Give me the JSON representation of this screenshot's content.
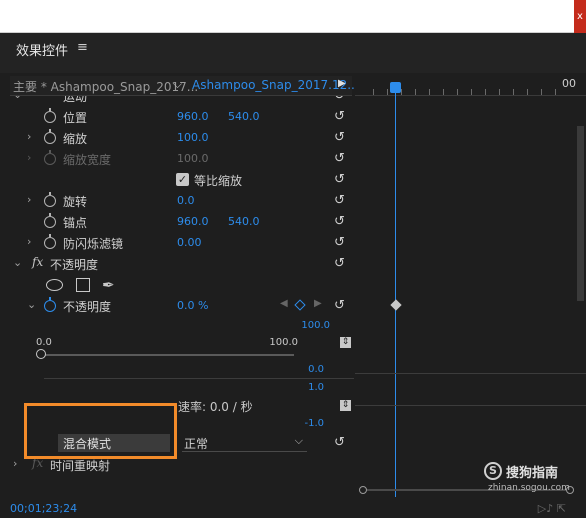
{
  "panel": {
    "title": "效果控件",
    "menu_icon": "≡"
  },
  "tabs": {
    "master": "主要 * Ashampoo_Snap_2017...",
    "chevron": "⌵",
    "clip": "Ashampoo_Snap_2017.12...",
    "arrow": "▶"
  },
  "timeline": {
    "ruler_label": "00"
  },
  "motion": {
    "cut_label": "运动",
    "rows": [
      {
        "label": "位置",
        "v1": "960.0",
        "v2": "540.0"
      },
      {
        "label": "缩放",
        "v1": "100.0"
      },
      {
        "label": "缩放宽度",
        "v1": "100.0",
        "disabled": true
      },
      {
        "label": "等比缩放",
        "checked": true
      },
      {
        "label": "旋转",
        "v1": "0.0"
      },
      {
        "label": "锚点",
        "v1": "960.0",
        "v2": "540.0"
      },
      {
        "label": "防闪烁滤镜",
        "v1": "0.00"
      }
    ]
  },
  "opacity": {
    "header": "不透明度",
    "fx": "fx",
    "row_label": "不透明度",
    "value": "0.0 %",
    "graph": {
      "max": "100.0",
      "min_left": "0.0",
      "max_mid": "100.0",
      "zero": "0.0",
      "one": "1.0",
      "minus_one": "-1.0",
      "speed": "速率: 0.0 / 秒"
    },
    "blend_label": "混合模式",
    "blend_value": "正常"
  },
  "time_remap": {
    "fx": "fx",
    "label": "时间重映射"
  },
  "footer": {
    "timecode": "00;01;23;24",
    "icons": "▷♪  ⇱"
  },
  "watermark": {
    "logo": "S",
    "text": "搜狗指南",
    "sub": "zhinan.sogou.com"
  },
  "icons": {
    "close": "x",
    "reset": "↺",
    "checkmark": "✓",
    "pen": "✒",
    "updown": "⇕",
    "collapsed": "›",
    "expanded": "⌄"
  }
}
